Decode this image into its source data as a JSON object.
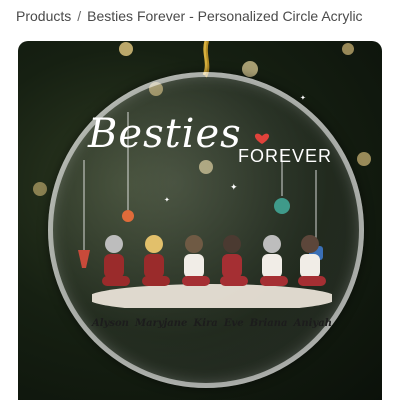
{
  "breadcrumb": {
    "items": [
      "Products",
      "Besties Forever - Personalized Circle Acrylic"
    ],
    "separator": "/"
  },
  "ornament": {
    "title": "Besties",
    "subtitle": "FOREVER",
    "names": [
      "Alyson",
      "Maryjane",
      "Kira",
      "Eve",
      "Briana",
      "Aniyah"
    ]
  },
  "colors": {
    "background": "#0b110a",
    "accent_heart": "#e0423b"
  }
}
